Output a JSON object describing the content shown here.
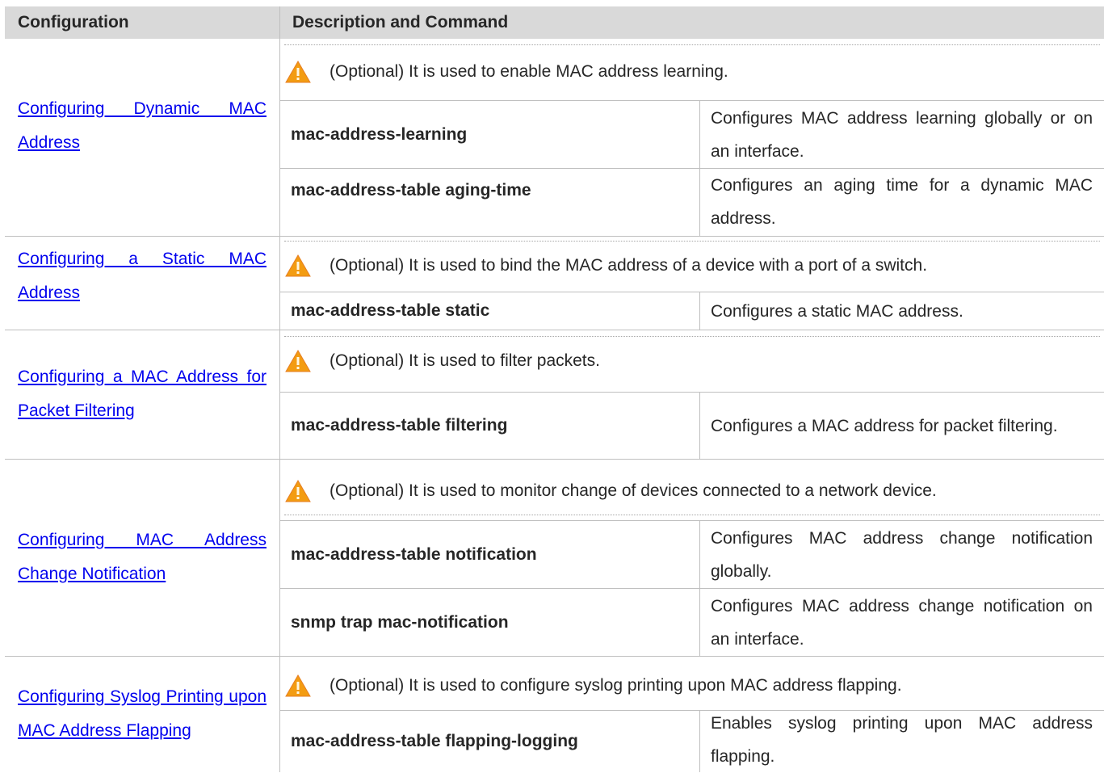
{
  "table": {
    "headers": {
      "configuration": "Configuration",
      "description": "Description and Command"
    },
    "sections": [
      {
        "link": "Configuring Dynamic MAC Address",
        "optional": "(Optional) It is used to enable MAC address learning.",
        "commands": [
          {
            "command": "mac-address-learning",
            "description": "Configures MAC address learning globally or on an interface."
          },
          {
            "command": "mac-address-table aging-time",
            "description": "Configures an aging time for a dynamic MAC address."
          }
        ]
      },
      {
        "link": "Configuring a Static MAC Address",
        "optional": "(Optional) It is used to bind the MAC address of a device with a port of a switch.",
        "commands": [
          {
            "command": "mac-address-table static",
            "description": "Configures a static MAC address."
          }
        ]
      },
      {
        "link": "Configuring a MAC Address for Packet Filtering",
        "optional": "(Optional) It is used to filter packets.",
        "commands": [
          {
            "command": "mac-address-table filtering",
            "description": "Configures a MAC address for packet filtering."
          }
        ]
      },
      {
        "link": "Configuring MAC Address Change Notification",
        "optional": "(Optional) It is used to monitor change of devices connected to a network device.",
        "commands": [
          {
            "command": "mac-address-table notification",
            "description": "Configures MAC address change notification globally."
          },
          {
            "command": "snmp trap mac-notification",
            "description": "Configures MAC address change notification on an interface."
          }
        ]
      },
      {
        "link": "Configuring Syslog Printing upon MAC Address Flapping",
        "optional": "(Optional) It is used to configure syslog printing upon MAC address flapping.",
        "commands": [
          {
            "command": "mac-address-table flapping-logging",
            "description": "Enables syslog printing upon MAC address flapping."
          }
        ]
      }
    ]
  },
  "colors": {
    "header_bg": "#d9d9d9",
    "link": "#0000ee",
    "warning_icon": "#f39c12",
    "border": "#bfbfbf"
  },
  "icons": {
    "optional_marker": "warning-icon"
  }
}
